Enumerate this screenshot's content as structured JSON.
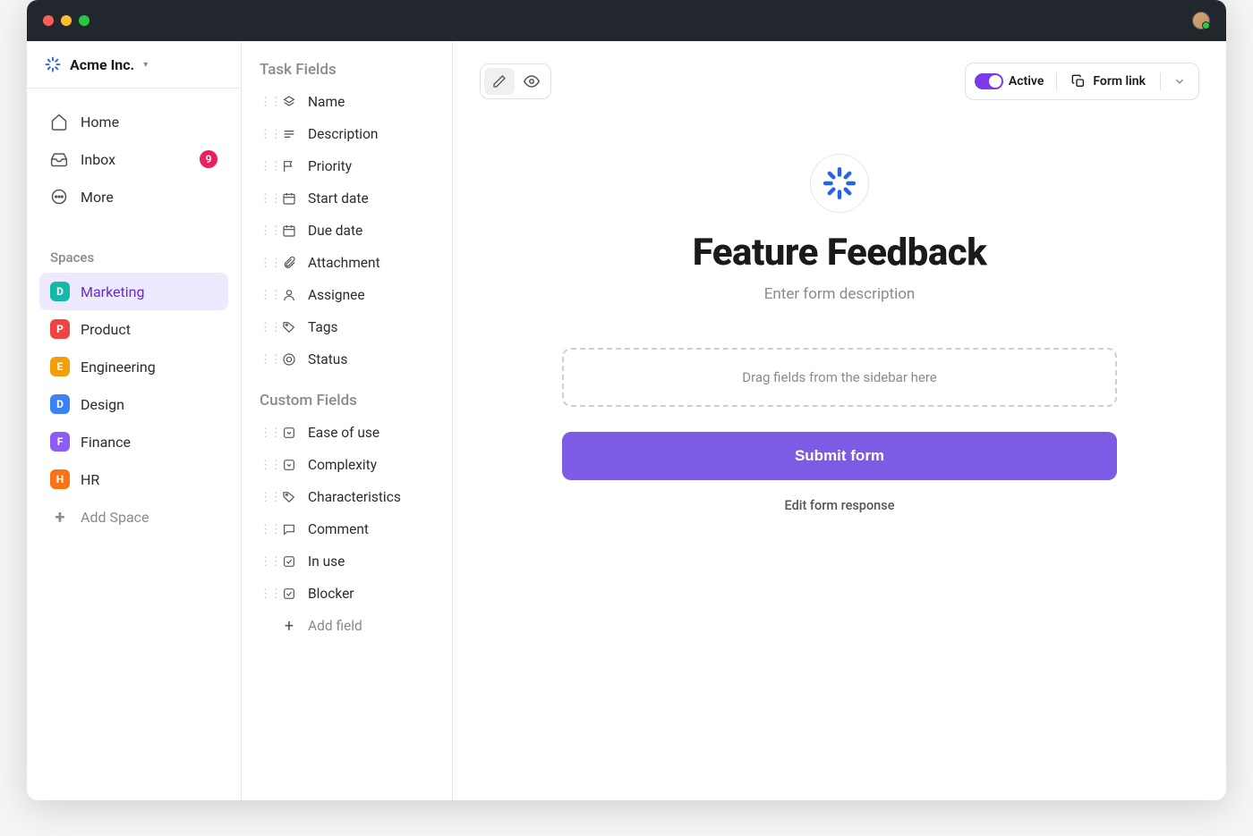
{
  "workspace": {
    "name": "Acme Inc."
  },
  "nav": {
    "home": "Home",
    "inbox": "Inbox",
    "inbox_badge": "9",
    "more": "More"
  },
  "spaces": {
    "heading": "Spaces",
    "items": [
      {
        "letter": "D",
        "label": "Marketing",
        "color": "#14b8a6",
        "active": true
      },
      {
        "letter": "P",
        "label": "Product",
        "color": "#ef4444"
      },
      {
        "letter": "E",
        "label": "Engineering",
        "color": "#f59e0b"
      },
      {
        "letter": "D",
        "label": "Design",
        "color": "#3b82f6"
      },
      {
        "letter": "F",
        "label": "Finance",
        "color": "#8b5cf6"
      },
      {
        "letter": "H",
        "label": "HR",
        "color": "#f97316"
      }
    ],
    "add_label": "Add Space"
  },
  "task_fields": {
    "heading": "Task Fields",
    "items": [
      {
        "icon": "title",
        "label": "Name"
      },
      {
        "icon": "text",
        "label": "Description"
      },
      {
        "icon": "flag",
        "label": "Priority"
      },
      {
        "icon": "calendar",
        "label": "Start date"
      },
      {
        "icon": "calendar",
        "label": "Due date"
      },
      {
        "icon": "attachment",
        "label": "Attachment"
      },
      {
        "icon": "person",
        "label": "Assignee"
      },
      {
        "icon": "tag",
        "label": "Tags"
      },
      {
        "icon": "status",
        "label": "Status"
      }
    ]
  },
  "custom_fields": {
    "heading": "Custom Fields",
    "items": [
      {
        "icon": "dropdown",
        "label": "Ease of use"
      },
      {
        "icon": "dropdown",
        "label": "Complexity"
      },
      {
        "icon": "tag",
        "label": "Characteristics"
      },
      {
        "icon": "comment",
        "label": "Comment"
      },
      {
        "icon": "checkbox",
        "label": "In use"
      },
      {
        "icon": "checkbox",
        "label": "Blocker"
      }
    ],
    "add_label": "Add field"
  },
  "toolbar": {
    "active_label": "Active",
    "form_link_label": "Form link"
  },
  "form": {
    "title": "Feature Feedback",
    "description_placeholder": "Enter form description",
    "dropzone_text": "Drag fields from the sidebar here",
    "submit_label": "Submit form",
    "response_link": "Edit form response"
  }
}
